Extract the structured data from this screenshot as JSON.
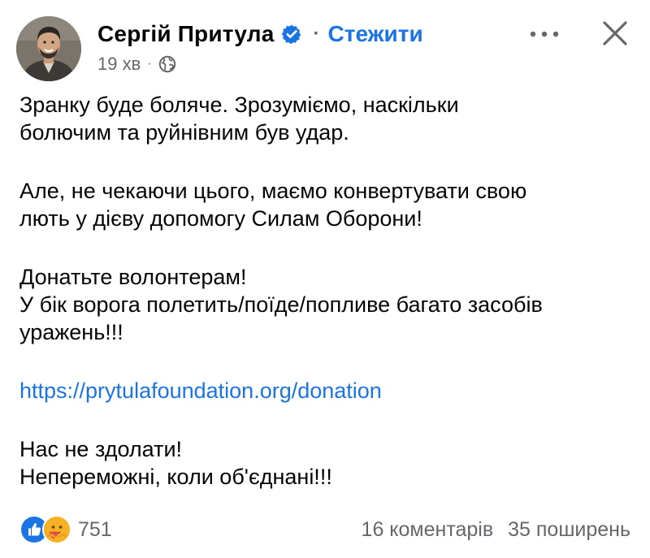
{
  "author": {
    "name": "Сергій Притула",
    "follow_label": "Стежити",
    "separator": "·"
  },
  "meta": {
    "timestamp": "19 хв",
    "separator": "·",
    "privacy_icon": "globe-icon"
  },
  "header_actions": {
    "more_icon": "more-horizontal-icon",
    "close_icon": "close-icon"
  },
  "post": {
    "p1": [
      "Зранку буде боляче. Зрозуміємо, наскільки",
      "болючим та руйнівним був удар."
    ],
    "p2": [
      "Але, не чекаючи цього, маємо конвертувати свою",
      "лють у дієву допомогу Силам Оборони!"
    ],
    "p3": [
      "Донатьте волонтерам!",
      "У бік ворога полетить/поїде/попливе багато засобів",
      "уражень!!!"
    ],
    "link": "https://prytulafoundation.org/donation",
    "p4": [
      "Нас не здолати!",
      "Непереможні, коли об'єднані!!!"
    ]
  },
  "footer": {
    "reaction_icons": [
      "like-icon",
      "care-icon"
    ],
    "reaction_count": "751",
    "comments": "16 коментарів",
    "shares": "35 поширень"
  },
  "colors": {
    "link": "#1b74e4",
    "secondary_text": "#65676b",
    "text": "#050505",
    "like": "#1b74e4",
    "care": "#f7b125"
  }
}
